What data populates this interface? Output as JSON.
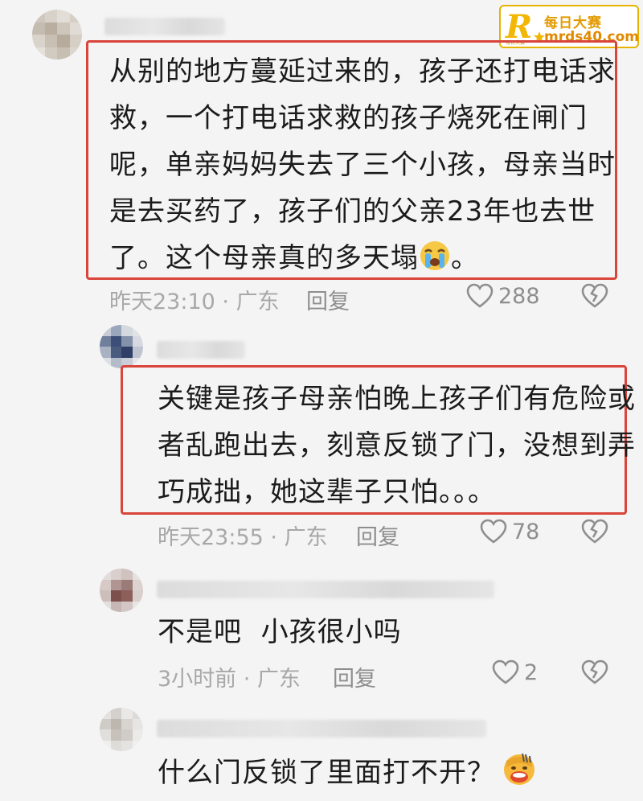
{
  "watermark": {
    "logo_letter": "R",
    "logo_sub": "每日大赛",
    "title": "每日大赛",
    "url": "mrds40.com"
  },
  "comments": [
    {
      "text": "从别的地方蔓延过来的，孩子还打电话求\n救，一个打电话求救的孩子烧死在闸门\n呢，单亲妈妈失去了三个小孩，母亲当时\n是去买药了，孩子们的父亲23年也去世\n了。这个母亲真的多天塌",
      "text_tail": "。",
      "emoji": "crying-face",
      "time": "昨天23:10",
      "location": "广东",
      "reply_label": "回复",
      "likes": "288",
      "highlighted": true
    },
    {
      "text": "关键是孩子母亲怕晚上孩子们有危险或\n者乱跑出去，刻意反锁了门，没想到弄\n巧成拙，她这辈子只怕。。。",
      "time": "昨天23:55",
      "location": "广东",
      "reply_label": "回复",
      "likes": "78",
      "highlighted": true
    },
    {
      "text": "不是吧  小孩很小吗",
      "time": "3小时前",
      "location": "广东",
      "reply_label": "回复",
      "likes": "2",
      "highlighted": false
    },
    {
      "text": "什么门反锁了里面打不开？",
      "emoji": "scared-face",
      "highlighted": false
    }
  ],
  "separator": " · ",
  "colors": {
    "highlight_border": "#d9443b",
    "meta_text": "#a8a8a8",
    "background": "#f4f4f4"
  }
}
